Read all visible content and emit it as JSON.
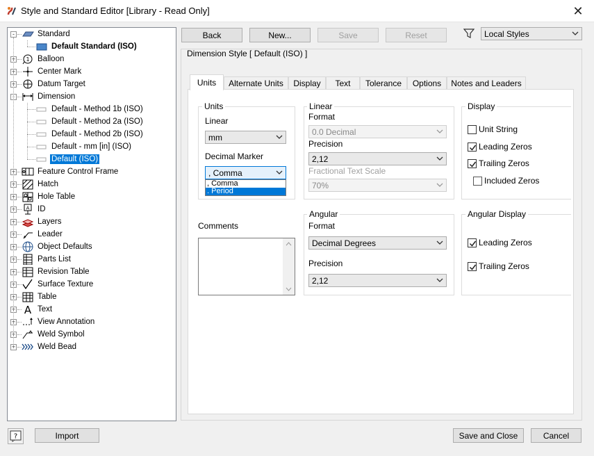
{
  "window": {
    "title": "Style and Standard Editor [Library - Read Only]"
  },
  "tree": {
    "items": [
      {
        "label": "Standard",
        "icon": "standard-icon"
      },
      {
        "label": "Default Standard (ISO)",
        "icon": "standard-item-icon"
      },
      {
        "label": "Balloon",
        "icon": "balloon-icon"
      },
      {
        "label": "Center Mark",
        "icon": "center-mark-icon"
      },
      {
        "label": "Datum Target",
        "icon": "datum-target-icon"
      },
      {
        "label": "Dimension",
        "icon": "dimension-icon"
      },
      {
        "label": "Default - Method 1b (ISO)",
        "icon": "dimension-style-icon"
      },
      {
        "label": "Default - Method 2a (ISO)",
        "icon": "dimension-style-icon"
      },
      {
        "label": "Default - Method 2b (ISO)",
        "icon": "dimension-style-icon"
      },
      {
        "label": "Default - mm [in] (ISO)",
        "icon": "dimension-style-icon"
      },
      {
        "label": "Default (ISO)",
        "icon": "dimension-style-icon"
      },
      {
        "label": "Feature Control Frame",
        "icon": "feature-control-frame-icon"
      },
      {
        "label": "Hatch",
        "icon": "hatch-icon"
      },
      {
        "label": "Hole Table",
        "icon": "hole-table-icon"
      },
      {
        "label": "ID",
        "icon": "id-icon"
      },
      {
        "label": "Layers",
        "icon": "layers-icon"
      },
      {
        "label": "Leader",
        "icon": "leader-icon"
      },
      {
        "label": "Object Defaults",
        "icon": "object-defaults-icon"
      },
      {
        "label": "Parts List",
        "icon": "parts-list-icon"
      },
      {
        "label": "Revision Table",
        "icon": "revision-table-icon"
      },
      {
        "label": "Surface Texture",
        "icon": "surface-texture-icon"
      },
      {
        "label": "Table",
        "icon": "table-icon"
      },
      {
        "label": "Text",
        "icon": "text-icon"
      },
      {
        "label": "View Annotation",
        "icon": "view-annotation-icon"
      },
      {
        "label": "Weld Symbol",
        "icon": "weld-symbol-icon"
      },
      {
        "label": "Weld Bead",
        "icon": "weld-bead-icon"
      }
    ]
  },
  "toolbar": {
    "back": "Back",
    "new": "New...",
    "save": "Save",
    "reset": "Reset",
    "filter_value": "Local Styles"
  },
  "panel": {
    "title": "Dimension Style [ Default (ISO) ]",
    "tabs": [
      "Units",
      "Alternate Units",
      "Display",
      "Text",
      "Tolerance",
      "Options",
      "Notes and Leaders"
    ]
  },
  "units_group": {
    "title": "Units",
    "linear_label": "Linear",
    "linear_value": "mm",
    "decimal_marker_label": "Decimal Marker",
    "decimal_marker_value": ", Comma",
    "options": [
      ", Comma",
      ". Period"
    ]
  },
  "linear_group": {
    "title": "Linear",
    "format_label": "Format",
    "format_value": "0.0 Decimal",
    "precision_label": "Precision",
    "precision_value": "2,12",
    "fractional_label": "Fractional Text Scale",
    "fractional_value": "70%"
  },
  "display_group": {
    "title": "Display",
    "unit_string": "Unit String",
    "leading_zeros": "Leading Zeros",
    "trailing_zeros": "Trailing Zeros",
    "included_zeros": "Included Zeros"
  },
  "comments": {
    "label": "Comments"
  },
  "angular_group": {
    "title": "Angular",
    "format_label": "Format",
    "format_value": "Decimal Degrees",
    "precision_label": "Precision",
    "precision_value": "2,12"
  },
  "angular_display_group": {
    "title": "Angular Display",
    "leading_zeros": "Leading Zeros",
    "trailing_zeros": "Trailing Zeros"
  },
  "footer": {
    "import": "Import",
    "save_close": "Save and Close",
    "cancel": "Cancel"
  },
  "colors": {
    "selection": "#0078d7",
    "accent": "#1f6fc5"
  }
}
